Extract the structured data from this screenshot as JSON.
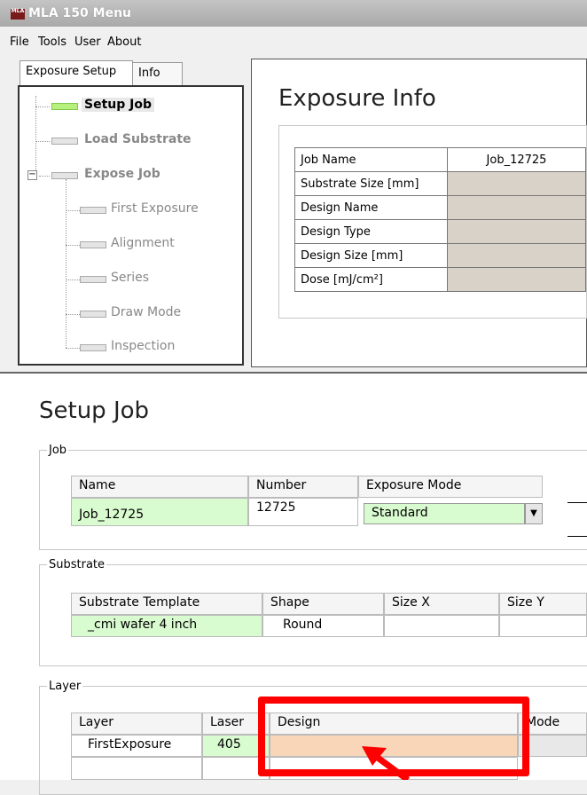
{
  "window": {
    "title": "MLA 150 Menu",
    "logo_text": "MLA"
  },
  "menu": [
    "File",
    "Tools",
    "User",
    "About"
  ],
  "tabs": [
    {
      "label": "Exposure Setup",
      "active": true
    },
    {
      "label": "Info",
      "active": false
    }
  ],
  "tree": {
    "items": [
      {
        "label": "Setup Job",
        "level": 0,
        "active": true
      },
      {
        "label": "Load Substrate",
        "level": 0
      },
      {
        "label": "Expose Job",
        "level": 0,
        "expandable": true
      },
      {
        "label": "First Exposure",
        "level": 1
      },
      {
        "label": "Alignment",
        "level": 1
      },
      {
        "label": "Series",
        "level": 1
      },
      {
        "label": "Draw Mode",
        "level": 1
      },
      {
        "label": "Inspection",
        "level": 1
      }
    ]
  },
  "exposure_info": {
    "title": "Exposure Info",
    "rows": [
      {
        "label": "Job Name",
        "value": "Job_12725"
      },
      {
        "label": "Substrate Size [mm]",
        "value": ""
      },
      {
        "label": "Design Name",
        "value": ""
      },
      {
        "label": "Design Type",
        "value": ""
      },
      {
        "label": "Design Size [mm]",
        "value": ""
      },
      {
        "label": "Dose [mJ/cm²]",
        "value": ""
      }
    ]
  },
  "setup_job": {
    "title": "Setup Job",
    "job_group": "Job",
    "job": {
      "headers": {
        "name": "Name",
        "number": "Number",
        "exposure_mode": "Exposure Mode"
      },
      "name": "Job_12725",
      "number": "12725",
      "exposure_mode": "Standard"
    },
    "substrate_group": "Substrate",
    "substrate": {
      "headers": {
        "template": "Substrate Template",
        "shape": "Shape",
        "size_x": "Size X",
        "size_y": "Size Y"
      },
      "template": "_cmi wafer 4 inch",
      "shape": "Round",
      "size_x": "",
      "size_y": ""
    },
    "layer_group": "Layer",
    "layer": {
      "headers": {
        "layer": "Layer",
        "laser": "Laser",
        "design": "Design",
        "mode": "Mode"
      },
      "layer": "FirstExposure",
      "laser": "405",
      "design": "",
      "mode": ""
    }
  },
  "colors": {
    "highlight": "#ff0000",
    "active_node": "#b6f07e",
    "field_green": "#d9fbd0",
    "field_peach": "#f9d6b8"
  }
}
